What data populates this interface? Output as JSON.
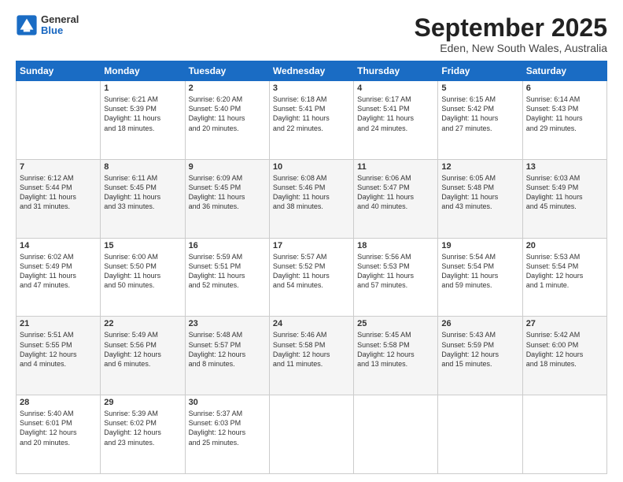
{
  "header": {
    "logo": {
      "general": "General",
      "blue": "Blue"
    },
    "title": "September 2025",
    "subtitle": "Eden, New South Wales, Australia"
  },
  "weekdays": [
    "Sunday",
    "Monday",
    "Tuesday",
    "Wednesday",
    "Thursday",
    "Friday",
    "Saturday"
  ],
  "weeks": [
    [
      {
        "day": "",
        "data": ""
      },
      {
        "day": "1",
        "data": "Sunrise: 6:21 AM\nSunset: 5:39 PM\nDaylight: 11 hours\nand 18 minutes."
      },
      {
        "day": "2",
        "data": "Sunrise: 6:20 AM\nSunset: 5:40 PM\nDaylight: 11 hours\nand 20 minutes."
      },
      {
        "day": "3",
        "data": "Sunrise: 6:18 AM\nSunset: 5:41 PM\nDaylight: 11 hours\nand 22 minutes."
      },
      {
        "day": "4",
        "data": "Sunrise: 6:17 AM\nSunset: 5:41 PM\nDaylight: 11 hours\nand 24 minutes."
      },
      {
        "day": "5",
        "data": "Sunrise: 6:15 AM\nSunset: 5:42 PM\nDaylight: 11 hours\nand 27 minutes."
      },
      {
        "day": "6",
        "data": "Sunrise: 6:14 AM\nSunset: 5:43 PM\nDaylight: 11 hours\nand 29 minutes."
      }
    ],
    [
      {
        "day": "7",
        "data": "Sunrise: 6:12 AM\nSunset: 5:44 PM\nDaylight: 11 hours\nand 31 minutes."
      },
      {
        "day": "8",
        "data": "Sunrise: 6:11 AM\nSunset: 5:45 PM\nDaylight: 11 hours\nand 33 minutes."
      },
      {
        "day": "9",
        "data": "Sunrise: 6:09 AM\nSunset: 5:45 PM\nDaylight: 11 hours\nand 36 minutes."
      },
      {
        "day": "10",
        "data": "Sunrise: 6:08 AM\nSunset: 5:46 PM\nDaylight: 11 hours\nand 38 minutes."
      },
      {
        "day": "11",
        "data": "Sunrise: 6:06 AM\nSunset: 5:47 PM\nDaylight: 11 hours\nand 40 minutes."
      },
      {
        "day": "12",
        "data": "Sunrise: 6:05 AM\nSunset: 5:48 PM\nDaylight: 11 hours\nand 43 minutes."
      },
      {
        "day": "13",
        "data": "Sunrise: 6:03 AM\nSunset: 5:49 PM\nDaylight: 11 hours\nand 45 minutes."
      }
    ],
    [
      {
        "day": "14",
        "data": "Sunrise: 6:02 AM\nSunset: 5:49 PM\nDaylight: 11 hours\nand 47 minutes."
      },
      {
        "day": "15",
        "data": "Sunrise: 6:00 AM\nSunset: 5:50 PM\nDaylight: 11 hours\nand 50 minutes."
      },
      {
        "day": "16",
        "data": "Sunrise: 5:59 AM\nSunset: 5:51 PM\nDaylight: 11 hours\nand 52 minutes."
      },
      {
        "day": "17",
        "data": "Sunrise: 5:57 AM\nSunset: 5:52 PM\nDaylight: 11 hours\nand 54 minutes."
      },
      {
        "day": "18",
        "data": "Sunrise: 5:56 AM\nSunset: 5:53 PM\nDaylight: 11 hours\nand 57 minutes."
      },
      {
        "day": "19",
        "data": "Sunrise: 5:54 AM\nSunset: 5:54 PM\nDaylight: 11 hours\nand 59 minutes."
      },
      {
        "day": "20",
        "data": "Sunrise: 5:53 AM\nSunset: 5:54 PM\nDaylight: 12 hours\nand 1 minute."
      }
    ],
    [
      {
        "day": "21",
        "data": "Sunrise: 5:51 AM\nSunset: 5:55 PM\nDaylight: 12 hours\nand 4 minutes."
      },
      {
        "day": "22",
        "data": "Sunrise: 5:49 AM\nSunset: 5:56 PM\nDaylight: 12 hours\nand 6 minutes."
      },
      {
        "day": "23",
        "data": "Sunrise: 5:48 AM\nSunset: 5:57 PM\nDaylight: 12 hours\nand 8 minutes."
      },
      {
        "day": "24",
        "data": "Sunrise: 5:46 AM\nSunset: 5:58 PM\nDaylight: 12 hours\nand 11 minutes."
      },
      {
        "day": "25",
        "data": "Sunrise: 5:45 AM\nSunset: 5:58 PM\nDaylight: 12 hours\nand 13 minutes."
      },
      {
        "day": "26",
        "data": "Sunrise: 5:43 AM\nSunset: 5:59 PM\nDaylight: 12 hours\nand 15 minutes."
      },
      {
        "day": "27",
        "data": "Sunrise: 5:42 AM\nSunset: 6:00 PM\nDaylight: 12 hours\nand 18 minutes."
      }
    ],
    [
      {
        "day": "28",
        "data": "Sunrise: 5:40 AM\nSunset: 6:01 PM\nDaylight: 12 hours\nand 20 minutes."
      },
      {
        "day": "29",
        "data": "Sunrise: 5:39 AM\nSunset: 6:02 PM\nDaylight: 12 hours\nand 23 minutes."
      },
      {
        "day": "30",
        "data": "Sunrise: 5:37 AM\nSunset: 6:03 PM\nDaylight: 12 hours\nand 25 minutes."
      },
      {
        "day": "",
        "data": ""
      },
      {
        "day": "",
        "data": ""
      },
      {
        "day": "",
        "data": ""
      },
      {
        "day": "",
        "data": ""
      }
    ]
  ]
}
